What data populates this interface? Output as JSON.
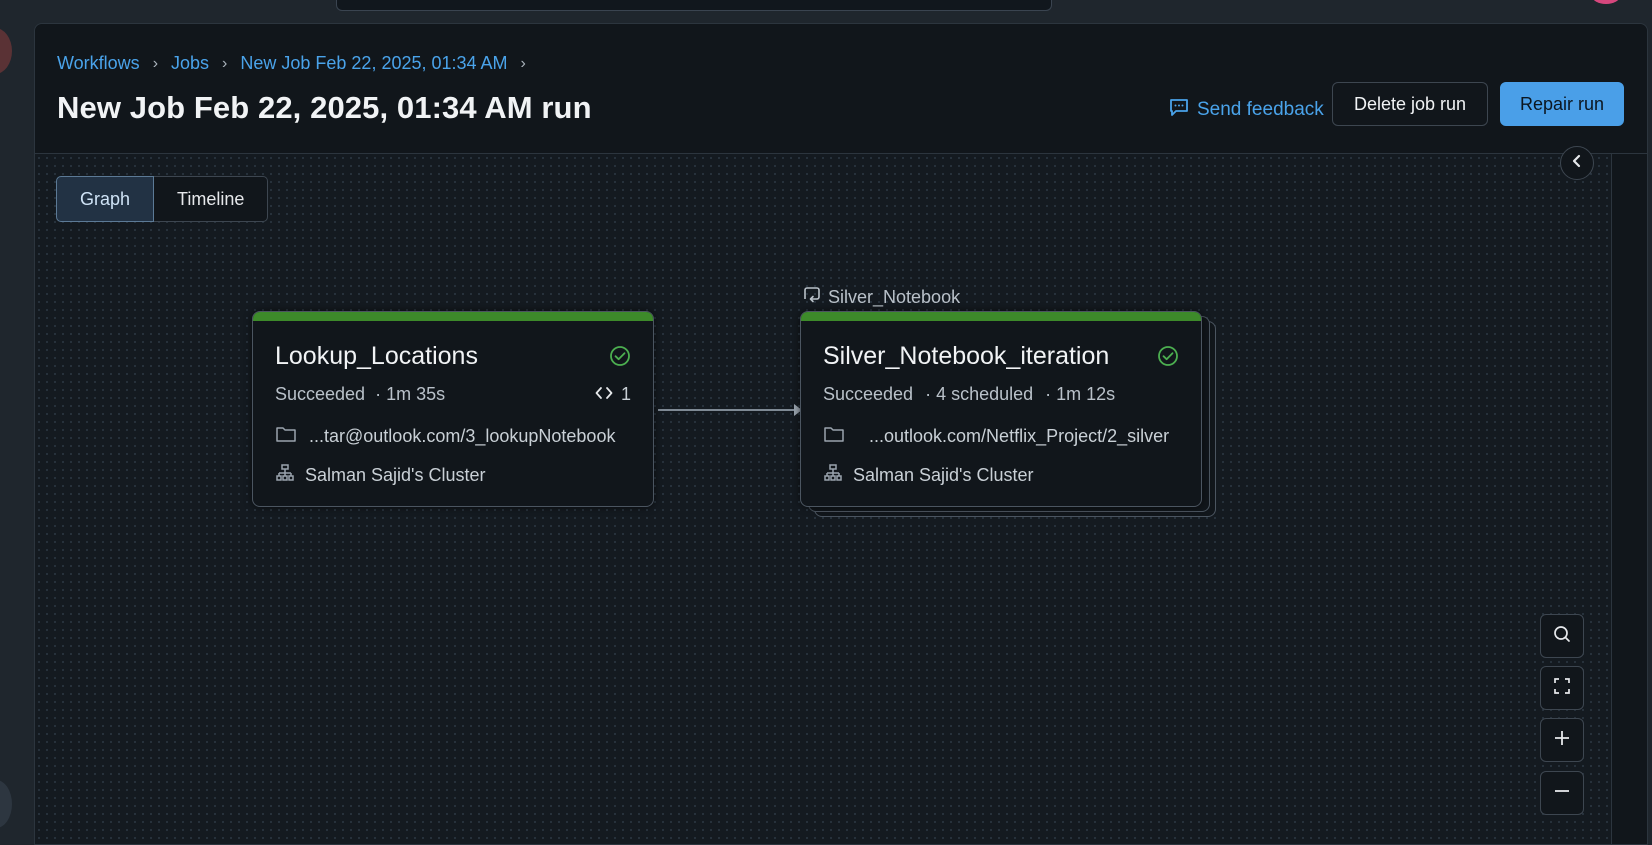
{
  "breadcrumb": {
    "items": [
      "Workflows",
      "Jobs",
      "New Job Feb 22, 2025, 01:34 AM"
    ],
    "separator": "›"
  },
  "page": {
    "title": "New Job Feb 22, 2025, 01:34 AM run"
  },
  "header_actions": {
    "feedback_label": "Send feedback",
    "delete_label": "Delete job run",
    "repair_label": "Repair run"
  },
  "view_toggle": {
    "options": [
      "Graph",
      "Timeline"
    ],
    "selected": "Graph"
  },
  "tasks": [
    {
      "name": "Lookup_Locations",
      "status": "Succeeded",
      "duration": "· 1m 35s",
      "iterations": "1",
      "path": "...tar@outlook.com/3_lookupNotebook",
      "cluster": "Salman Sajid's Cluster",
      "status_color": "#3d8a2a"
    },
    {
      "group_label": "Silver_Notebook",
      "name": "Silver_Notebook_iteration",
      "status": "Succeeded",
      "scheduled": "· 4 scheduled",
      "duration": "· 1m 12s",
      "path": "...outlook.com/Netflix_Project/2_silver",
      "cluster": "Salman Sajid's Cluster",
      "status_color": "#3d8a2a"
    }
  ],
  "icons": {
    "feedback": "chat-bubble-icon",
    "success": "check-circle-icon",
    "folder": "folder-icon",
    "cluster": "cluster-icon",
    "loop": "loop-icon",
    "code": "code-brackets-icon",
    "collapse": "chevron-left-icon",
    "zoom_controls": [
      "search-icon",
      "fit-screen-icon",
      "plus-icon",
      "minus-icon"
    ]
  },
  "colors": {
    "accent": "#4a9fe8",
    "success": "#3d8a2a",
    "background": "#11161b"
  }
}
